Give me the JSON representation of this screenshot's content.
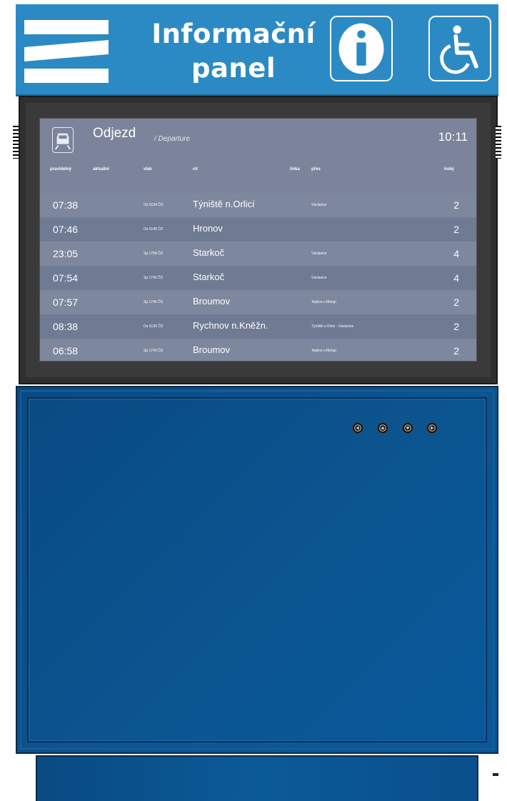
{
  "header": {
    "title_line1": "Informační",
    "title_line2": "panel",
    "logo_icon": "cd-logo-icon",
    "info_icon": "info-icon",
    "accessibility_icon": "wheelchair-icon"
  },
  "display": {
    "title": "Odjezd",
    "subtitle": "/ Departure",
    "clock": "10:11",
    "columns": {
      "scheduled": "pravidelný",
      "actual": "aktuální",
      "train": "vlak",
      "destination": "cíl",
      "line": "linka",
      "via": "přes",
      "platform": "kolej"
    },
    "rows": [
      {
        "time": "07:38",
        "train": "Os 5134 ČD",
        "destination": "Týniště n.Orlicí",
        "via": "Václavice",
        "platform": "2"
      },
      {
        "time": "07:46",
        "train": "Os 5145 ČD",
        "destination": "Hronov",
        "via": "",
        "platform": "2"
      },
      {
        "time": "23:05",
        "train": "Sp 1758 ČD",
        "destination": "Starkoč",
        "via": "Václavice",
        "platform": "4"
      },
      {
        "time": "07:54",
        "train": "Sp 1742 ČD",
        "destination": "Starkoč",
        "via": "Václavice",
        "platform": "4"
      },
      {
        "time": "07:57",
        "train": "Sp 1745 ČD",
        "destination": "Broumov",
        "via": "Teplice n.Metují",
        "platform": "2"
      },
      {
        "time": "08:38",
        "train": "Os 5136 ČD",
        "destination": "Rychnov n.Kněžn.",
        "via": "Týniště n.Orlicí - Václavice",
        "platform": "2"
      },
      {
        "time": "06:58",
        "train": "Sp 1743 ČD",
        "destination": "Broumov",
        "via": "Teplice n.Metují",
        "platform": "2"
      }
    ]
  },
  "controls": {
    "buttons": [
      "left-arrow-icon",
      "up-arrow-icon",
      "down-arrow-icon",
      "right-arrow-icon"
    ]
  },
  "colors": {
    "banner": "#2b8ac4",
    "housing": "#3a3a3a",
    "display": "#7b849a",
    "cabinet": "#0b5692"
  }
}
